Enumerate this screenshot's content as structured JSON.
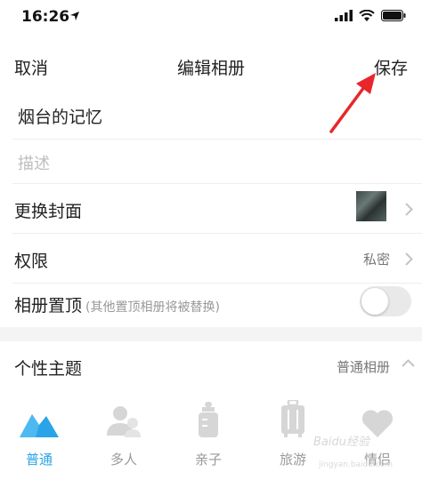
{
  "status_bar": {
    "time": "16:26"
  },
  "nav": {
    "cancel": "取消",
    "title": "编辑相册",
    "save": "保存"
  },
  "album": {
    "name_value": "烟台的记忆",
    "description_placeholder": "描述",
    "change_cover_label": "更换封面",
    "permission_label": "权限",
    "permission_value": "私密",
    "pin_label": "相册置顶",
    "pin_hint": "(其他置顶相册将被替换)",
    "pin_enabled": false
  },
  "theme": {
    "label": "个性主题",
    "value": "普通相册",
    "options": [
      {
        "name": "普通",
        "icon": "mountain-icon",
        "active": true
      },
      {
        "name": "多人",
        "icon": "people-icon",
        "active": false
      },
      {
        "name": "亲子",
        "icon": "baby-bottle-icon",
        "active": false
      },
      {
        "name": "旅游",
        "icon": "suitcase-icon",
        "active": false
      },
      {
        "name": "情侣",
        "icon": "heart-icon",
        "active": false
      }
    ]
  },
  "watermark": {
    "brand": "Baidu经验",
    "url": "jingyan.baidu.com"
  },
  "colors": {
    "accent": "#2aa3e8",
    "arrow": "#e8262b",
    "inactive_icon": "#d6d6d6"
  }
}
